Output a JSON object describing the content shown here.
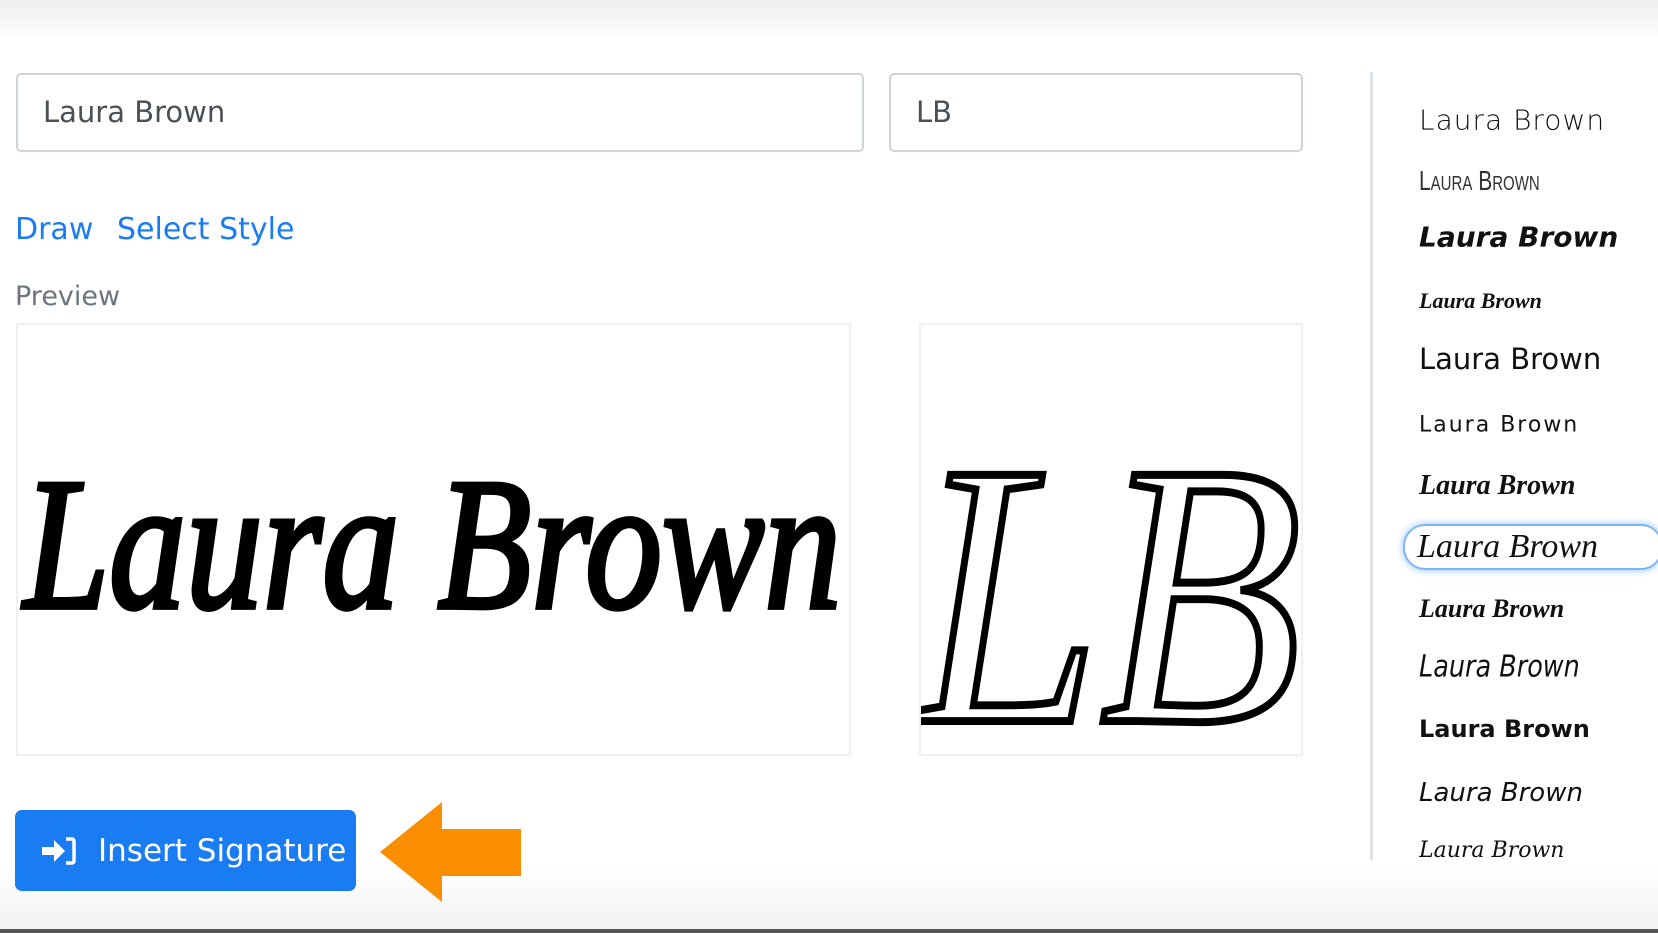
{
  "form": {
    "full_name_value": "Laura Brown",
    "initials_value": "LB"
  },
  "tabs": [
    {
      "label": "Draw"
    },
    {
      "label": "Select Style"
    }
  ],
  "preview": {
    "label": "Preview",
    "signature_text": "Laura Brown",
    "initials_text": "LB"
  },
  "insert_button": {
    "label": "Insert Signature",
    "icon": "sign-in-icon"
  },
  "annotation": {
    "arrow_color": "#f98e00",
    "icon": "arrow-left-icon"
  },
  "colors": {
    "accent": "#1a7cf2"
  },
  "styles": [
    {
      "label": "Laura Brown"
    },
    {
      "label": "Laura Brown"
    },
    {
      "label": "Laura Brown"
    },
    {
      "label": "Laura Brown"
    },
    {
      "label": "Laura Brown"
    },
    {
      "label": "Laura Brown"
    },
    {
      "label": "Laura Brown"
    },
    {
      "label": "Laura Brown",
      "selected": true
    },
    {
      "label": "Laura Brown"
    },
    {
      "label": "Laura Brown"
    },
    {
      "label": "Laura Brown"
    },
    {
      "label": "Laura Brown"
    },
    {
      "label": "Laura Brown"
    }
  ]
}
